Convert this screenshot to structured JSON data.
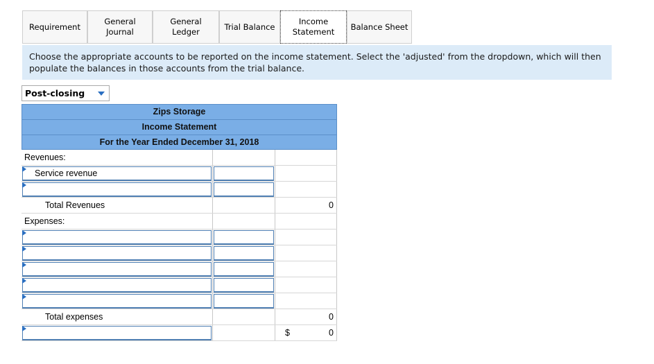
{
  "tabs": [
    {
      "label": "Requirement",
      "width": 94
    },
    {
      "label": "General\nJournal",
      "width": 94
    },
    {
      "label": "General\nLedger",
      "width": 96
    },
    {
      "label": "Trial Balance",
      "width": 88
    },
    {
      "label": "Income\nStatement",
      "width": 96
    },
    {
      "label": "Balance Sheet",
      "width": 94
    }
  ],
  "instructions": "Choose the appropriate accounts to be reported on the income statement. Select the 'adjusted' from the dropdown, which will then populate the balances in those accounts from the trial balance.",
  "dropdown": {
    "selected": "Post-closing"
  },
  "statement": {
    "company": "Zips Storage",
    "title": "Income Statement",
    "period": "For the Year Ended December 31, 2018",
    "revenues_label": "Revenues:",
    "service_revenue": "Service revenue",
    "total_revenues_label": "Total Revenues",
    "total_revenues_value": "0",
    "expenses_label": "Expenses:",
    "total_expenses_label": "Total expenses",
    "total_expenses_value": "0",
    "net_symbol": "$",
    "net_value": "0"
  }
}
